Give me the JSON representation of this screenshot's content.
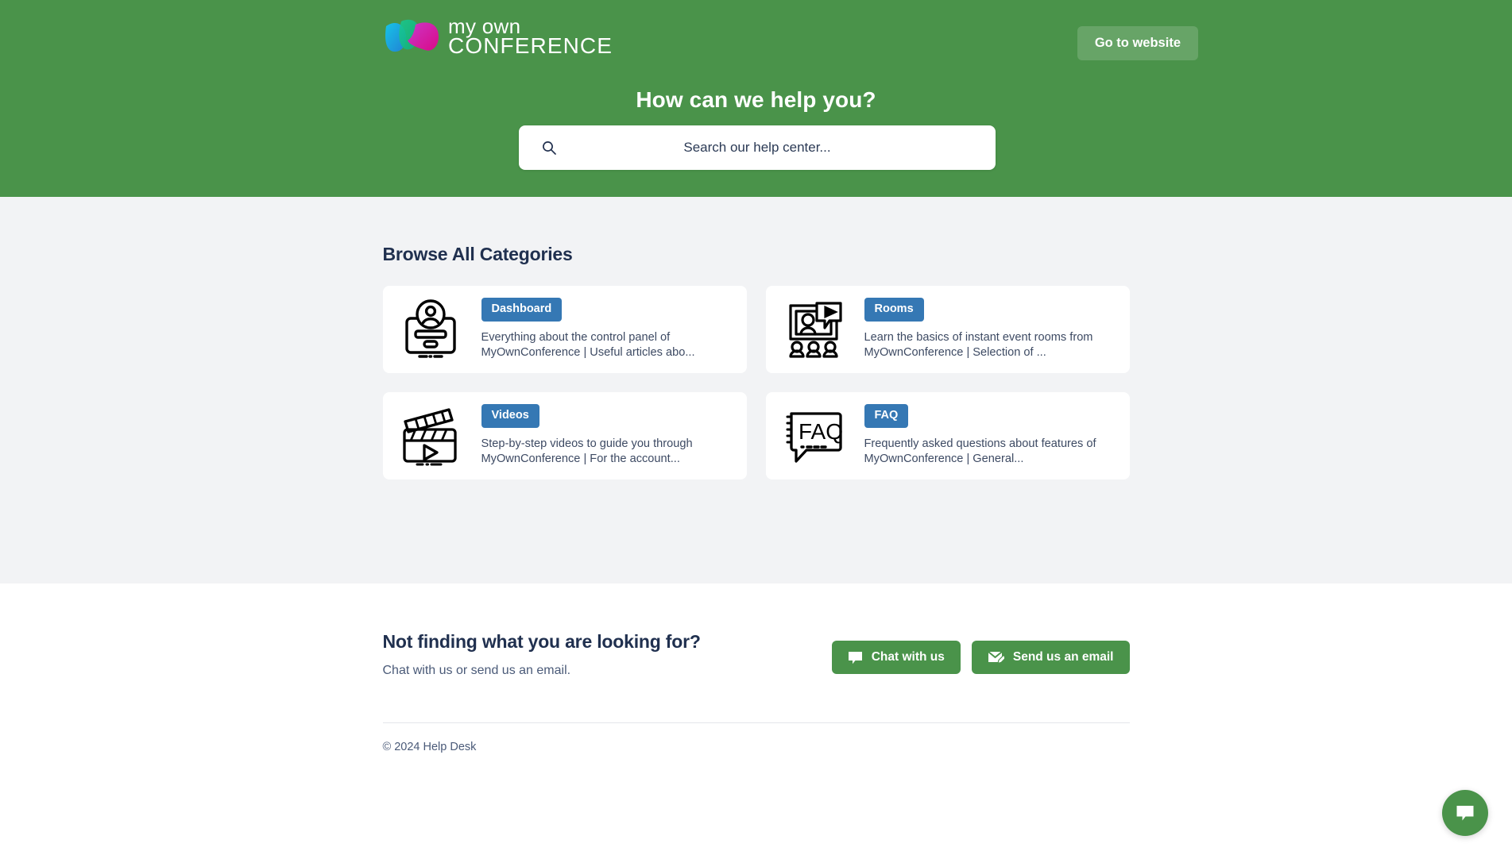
{
  "header": {
    "logo": {
      "line1": "my own",
      "line2": "CONFERENCE",
      "mark_colors": [
        "#00AEEF",
        "#00B96B",
        "#E3008C"
      ]
    },
    "go_to_website_label": "Go to website",
    "title": "How can we help you?",
    "search": {
      "placeholder": "Search our help center...",
      "value": ""
    },
    "background_color": "#4A934A"
  },
  "categories": {
    "section_title": "Browse All Categories",
    "badge_color": "#3578B4",
    "cards": [
      {
        "badge": "Dashboard",
        "description": "Everything about the control panel of MyOwnConference | Useful articles abo...",
        "icon": "monitor-user-icon"
      },
      {
        "badge": "Rooms",
        "description": "Learn the basics of instant event rooms from MyOwnConference | Selection of ...",
        "icon": "webinar-screen-icon"
      },
      {
        "badge": "Videos",
        "description": "Step-by-step videos to guide you through MyOwnConference | For the account...",
        "icon": "clapperboard-icon"
      },
      {
        "badge": "FAQ",
        "description": "Frequently asked questions about features of MyOwnConference | General...",
        "icon": "faq-bubble-icon"
      }
    ]
  },
  "contact": {
    "heading": "Not finding what you are looking for?",
    "subtext": "Chat with us or send us an email.",
    "chat_button_label": "Chat with us",
    "email_button_label": "Send us an email",
    "button_color": "#4A934A"
  },
  "footer": {
    "copyright": "© 2024 Help Desk"
  },
  "chat_widget": {
    "icon": "chat-bubble-icon",
    "color": "#4A934A"
  }
}
